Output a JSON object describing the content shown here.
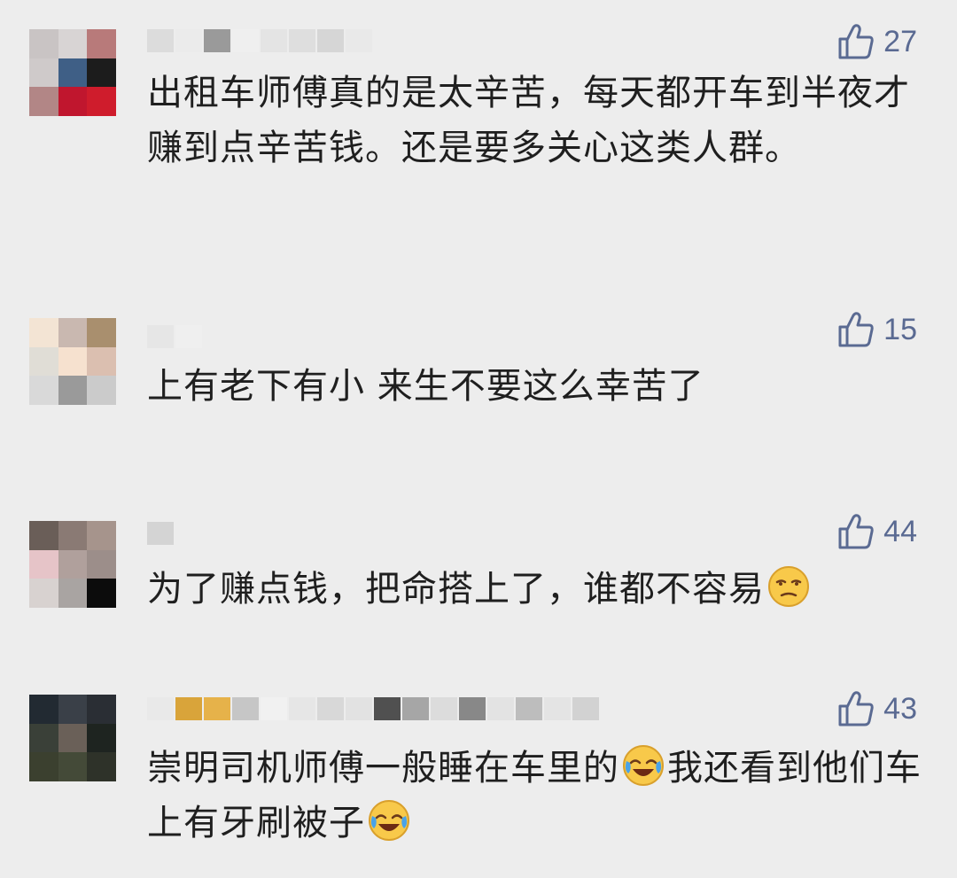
{
  "comments": [
    {
      "username": "",
      "likes": "27",
      "text": "出租车师傅真的是太辛苦，每天都开车到半夜才赚到点辛苦钱。还是要多关心这类人群。",
      "avatar_colors": [
        "#c9c4c4",
        "#d8d4d4",
        "#b87a7a",
        "#cfcaca",
        "#3f5f86",
        "#1c1c1c",
        "#b28686",
        "#c0162e",
        "#cf1c2c"
      ],
      "name_colors": [
        "#dcdcdc",
        "#ebebeb",
        "#9a9a9a",
        "#efefef",
        "#e4e4e4",
        "#dedede",
        "#d6d6d6",
        "#e9e9e9"
      ]
    },
    {
      "username": "",
      "likes": "15",
      "text": "上有老下有小 来生不要这么幸苦了",
      "avatar_colors": [
        "#f3e4d4",
        "#c9b8b0",
        "#a98f6e",
        "#e0ddd6",
        "#f6e1cf",
        "#dbbfb0",
        "#d9d9d9",
        "#9a9a9a",
        "#cbcbcb"
      ],
      "name_colors": [
        "#e6e6e6",
        "#efefef"
      ]
    },
    {
      "username": "",
      "likes": "44",
      "text": "为了赚点钱，把命搭上了，谁都不容易",
      "text_emoji": "unamused-emoji",
      "avatar_colors": [
        "#6a5e58",
        "#8a7a74",
        "#a6948c",
        "#e6c4c8",
        "#b0a09c",
        "#9c8e8a",
        "#d8d2d0",
        "#a9a4a2",
        "#0c0c0c"
      ],
      "name_colors": [
        "#d4d4d4"
      ]
    },
    {
      "username": "",
      "likes": "43",
      "text_part1": "崇明司机师傅一般睡在车里的",
      "text_part2": "我还看到他们车上有牙刷被子",
      "text_emoji": "crying-laughing-emoji",
      "avatar_colors": [
        "#222a32",
        "#3a4048",
        "#2a2e34",
        "#3a4038",
        "#6a6058",
        "#1e2420",
        "#3b402f",
        "#444a38",
        "#2e3229"
      ],
      "name_colors": [
        "#e9e9e9",
        "#d9a43a",
        "#e6b24a",
        "#c6c6c6",
        "#f1f1f1",
        "#e6e6e6",
        "#d8d8d8",
        "#e2e2e2",
        "#505050",
        "#a6a6a6",
        "#dcdcdc",
        "#888888",
        "#e3e3e3",
        "#bdbdbd",
        "#e4e4e4",
        "#d2d2d2"
      ]
    }
  ],
  "colors": {
    "background": "#ededed",
    "like_color": "#5a6a92",
    "text_color": "#1f1f1f"
  }
}
